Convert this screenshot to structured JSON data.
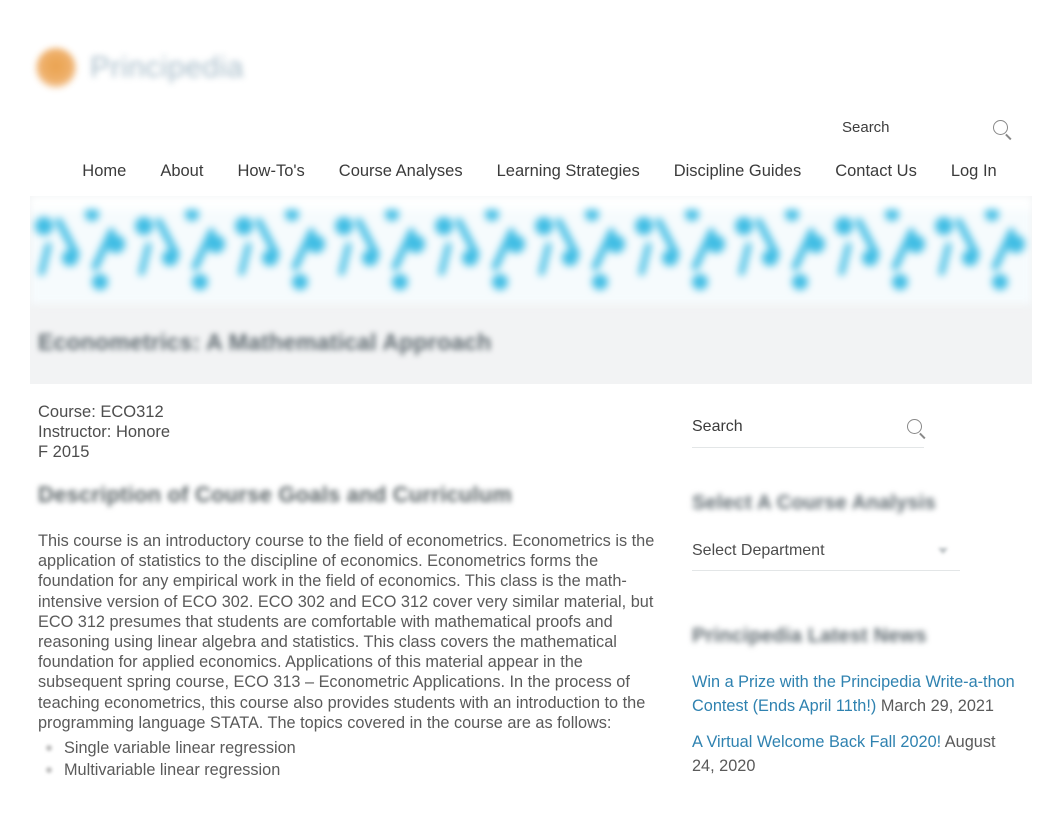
{
  "site": {
    "logo_text": "Principedia",
    "logo_mark": "orange-circle-icon"
  },
  "header": {
    "search": {
      "value": "Search",
      "placeholder": "Search",
      "icon": "search-icon"
    },
    "nav": [
      {
        "label": "Home"
      },
      {
        "label": "About"
      },
      {
        "label": "How-To's"
      },
      {
        "label": "Course Analyses"
      },
      {
        "label": "Learning Strategies"
      },
      {
        "label": "Discipline Guides"
      },
      {
        "label": "Contact Us"
      },
      {
        "label": "Log In"
      }
    ]
  },
  "hero": {
    "title": "Econometrics: A Mathematical Approach"
  },
  "main": {
    "course_line": "Course: ECO312",
    "instructor_line": "Instructor: Honore",
    "term_line": "F 2015",
    "section_title": "Description of Course Goals and Curriculum",
    "body": "This course is an introductory course to the field of econometrics. Econometrics is the application of statistics to the discipline of economics. Econometrics forms the foundation for any empirical work in the field of economics. This class is the math-intensive version of ECO 302. ECO 302 and ECO 312 cover very similar material, but ECO 312 presumes that students are comfortable with mathematical proofs and reasoning using linear algebra and statistics. This class covers the mathematical foundation for applied economics. Applications of this material appear in the subsequent spring course, ECO 313 – Econometric Applications. In the process of teaching econometrics, this course also provides students with an introduction to the programming language STATA. The topics covered in the course are as follows:",
    "topics": [
      "Single variable linear regression",
      "Multivariable linear regression"
    ]
  },
  "sidebar": {
    "search": {
      "value": "Search",
      "placeholder": "Search",
      "icon": "search-icon"
    },
    "course_widget": {
      "title": "Select A Course Analysis",
      "select_value": "Select Department",
      "caret": "chevron-down-icon"
    },
    "news_widget": {
      "title": "Principedia Latest News",
      "items": [
        {
          "link": "Win a Prize with the Principedia Write-a-thon Contest (Ends April 11th!)",
          "date": "March 29, 2021"
        },
        {
          "link": "A Virtual Welcome Back Fall 2020!",
          "date": "August 24, 2020"
        }
      ]
    }
  },
  "colors": {
    "link": "#2f82b0",
    "logo_mark": "#e99b40",
    "logo_word": "#9fb6c4",
    "pattern": "#4fc3e8",
    "banner_bg": "#f2f3f4"
  }
}
